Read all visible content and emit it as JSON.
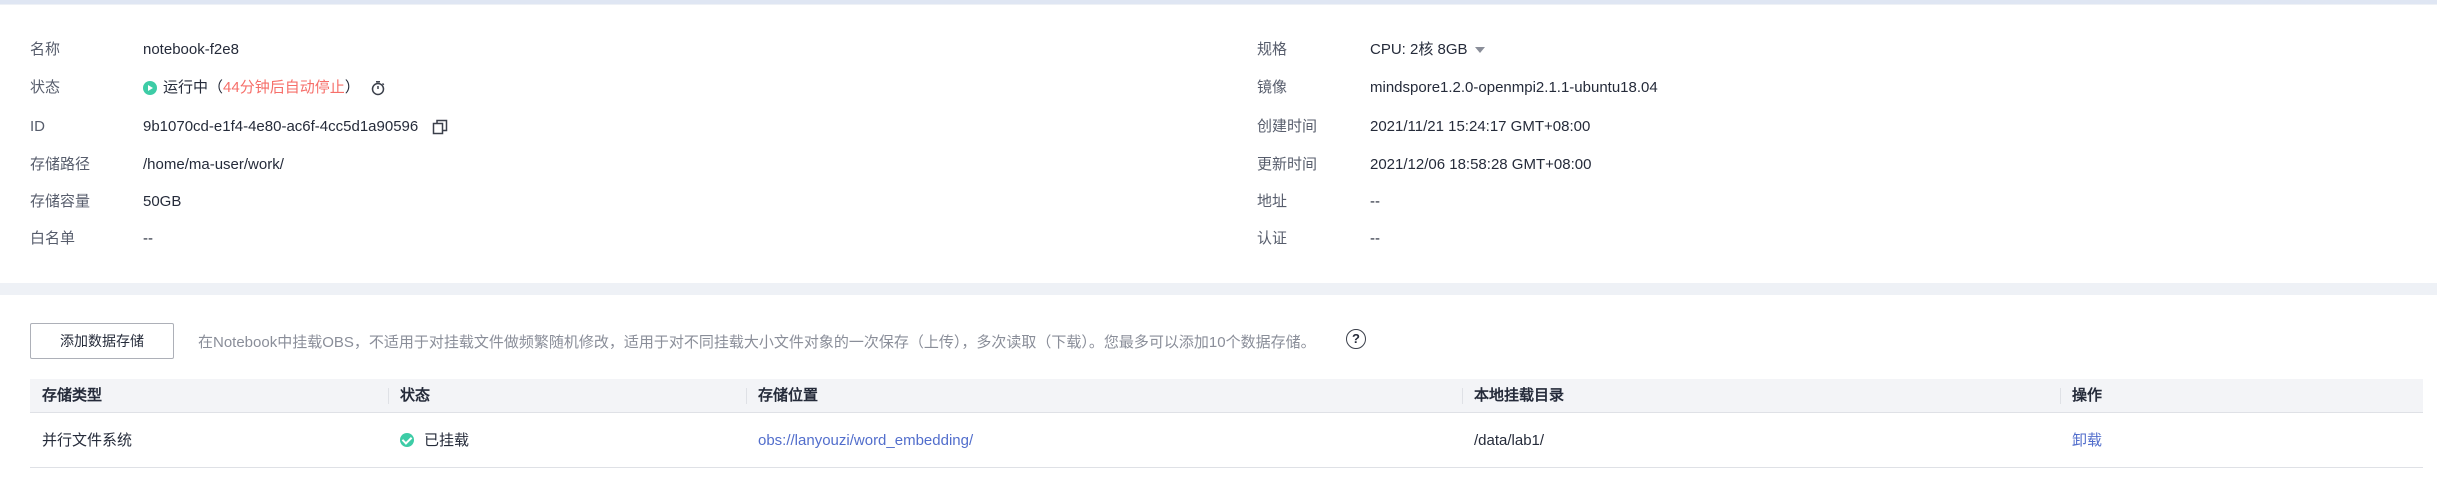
{
  "details": {
    "name": {
      "label": "名称",
      "value": "notebook-f2e8"
    },
    "status": {
      "label": "状态",
      "value": "运行中",
      "paren_open": "（",
      "auto_stop": "44分钟后自动停止",
      "paren_close": "）"
    },
    "id": {
      "label": "ID",
      "value": "9b1070cd-e1f4-4e80-ac6f-4cc5d1a90596"
    },
    "storage_path": {
      "label": "存储路径",
      "value": "/home/ma-user/work/"
    },
    "storage_capacity": {
      "label": "存储容量",
      "value": "50GB"
    },
    "whitelist": {
      "label": "白名单",
      "value": "--"
    },
    "spec": {
      "label": "规格",
      "value": "CPU: 2核 8GB"
    },
    "image": {
      "label": "镜像",
      "value": "mindspore1.2.0-openmpi2.1.1-ubuntu18.04"
    },
    "created": {
      "label": "创建时间",
      "value": "2021/11/21 15:24:17 GMT+08:00"
    },
    "updated": {
      "label": "更新时间",
      "value": "2021/12/06 18:58:28 GMT+08:00"
    },
    "address": {
      "label": "地址",
      "value": "--"
    },
    "auth": {
      "label": "认证",
      "value": "--"
    }
  },
  "storage": {
    "add_button": "添加数据存储",
    "hint": "在Notebook中挂载OBS，不适用于对挂载文件做频繁随机修改，适用于对不同挂载大小文件对象的一次保存（上传），多次读取（下载）。您最多可以添加10个数据存储。",
    "help": "?",
    "columns": [
      "存储类型",
      "状态",
      "存储位置",
      "本地挂载目录",
      "操作"
    ],
    "rows": [
      {
        "type": "并行文件系统",
        "status": "已挂载",
        "location": "obs://lanyouzi/word_embedding/",
        "mount_dir": "/data/lab1/",
        "action": "卸载"
      }
    ]
  },
  "colors": {
    "running": "#3dcca6",
    "auto_stop": "#f66f6a",
    "link": "#526ecc"
  },
  "icons": [
    "running-icon",
    "timer-icon",
    "copy-icon",
    "caret-down-icon",
    "help-icon",
    "mounted-check-icon"
  ]
}
